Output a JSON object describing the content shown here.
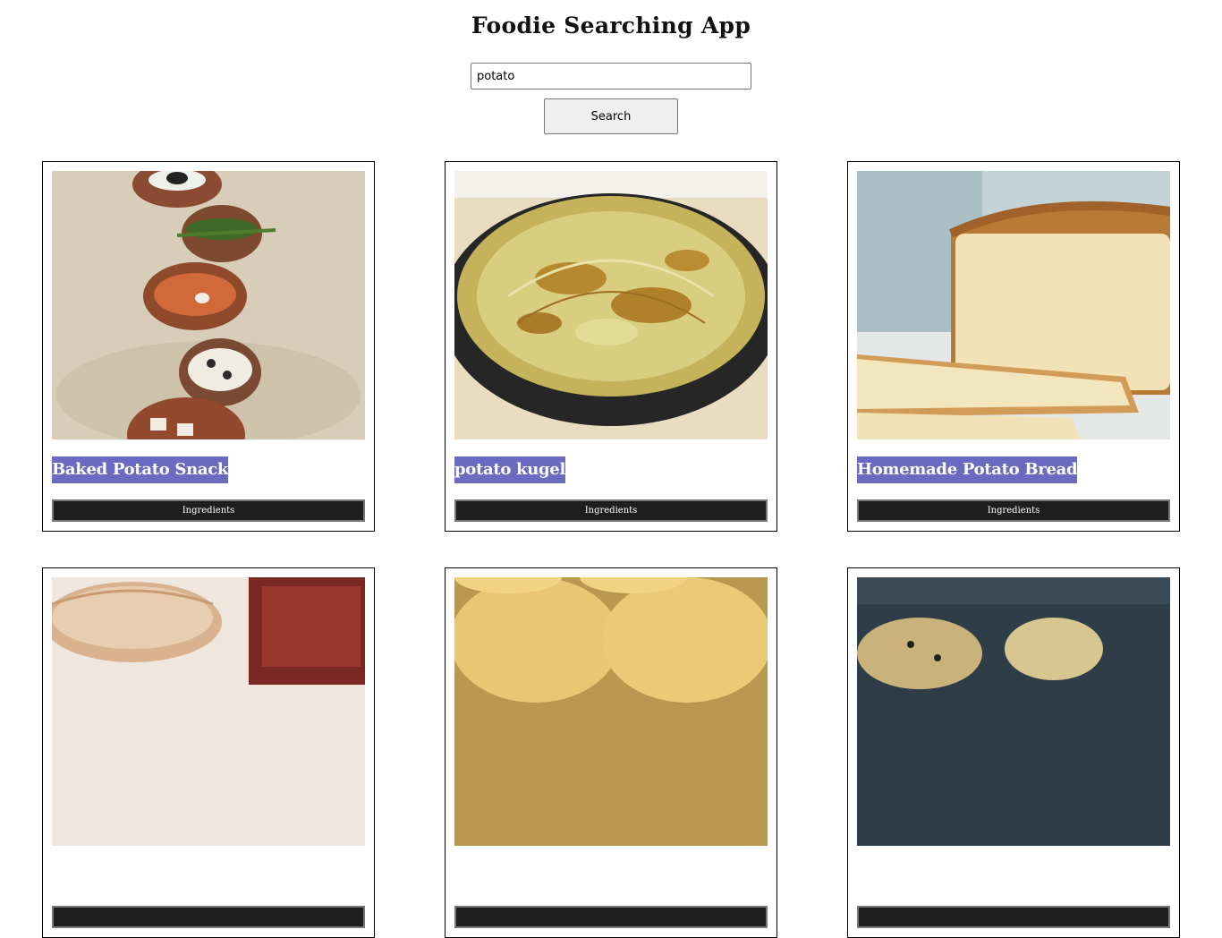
{
  "app": {
    "title": "Foodie Searching App"
  },
  "search": {
    "value": "potato",
    "button_label": "Search"
  },
  "recipes": [
    {
      "title": "Baked Potato Snack",
      "ingredients_label": "Ingredients",
      "image_icon": "baked-potato-image"
    },
    {
      "title": "potato kugel",
      "ingredients_label": "Ingredients",
      "image_icon": "potato-kugel-image"
    },
    {
      "title": "Homemade Potato Bread",
      "ingredients_label": "Ingredients",
      "image_icon": "potato-bread-image"
    },
    {
      "title": "",
      "ingredients_label": "",
      "image_icon": "potato-beef-image"
    },
    {
      "title": "",
      "ingredients_label": "",
      "image_icon": "potato-rolls-image"
    },
    {
      "title": "",
      "ingredients_label": "",
      "image_icon": "potato-bake-image"
    }
  ],
  "colors": {
    "title_highlight": "#6a6ac0",
    "ingredients_button_bg": "#1e1e1e",
    "card_border": "#000000"
  }
}
